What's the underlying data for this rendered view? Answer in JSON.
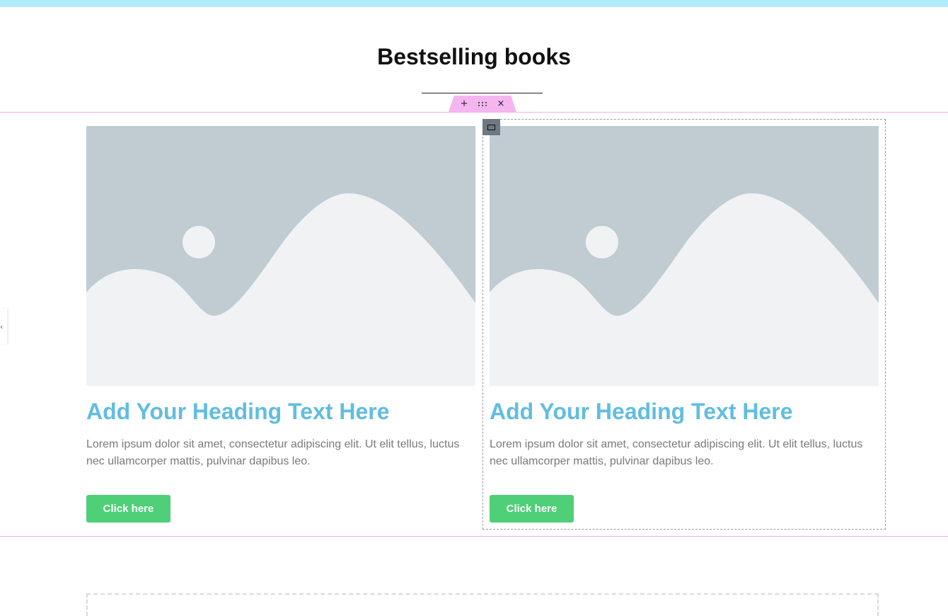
{
  "page": {
    "title": "Bestselling books"
  },
  "toolbar": {
    "add_icon": "+",
    "close_icon": "×",
    "collapse_icon": "‹"
  },
  "cards": [
    {
      "heading": "Add Your Heading Text Here",
      "text": "Lorem ipsum dolor sit amet, consectetur adipiscing elit. Ut elit tellus, luctus nec ullamcorper mattis, pulvinar dapibus leo.",
      "button_label": "Click here"
    },
    {
      "heading": "Add Your Heading Text Here",
      "text": "Lorem ipsum dolor sit amet, consectetur adipiscing elit. Ut elit tellus, luctus nec ullamcorper mattis, pulvinar dapibus leo.",
      "button_label": "Click here"
    }
  ],
  "colors": {
    "top_strip": "#b2ebfd",
    "section_outline": "#f5a9ee",
    "heading_accent": "#61bddf",
    "button": "#4fcf77",
    "placeholder_bg": "#c0ccd2",
    "placeholder_fg": "#f1f2f4"
  },
  "icons": {
    "image_placeholder": "image-placeholder-icon",
    "drag_handle": "drag-dots-icon",
    "column_handle": "column-icon"
  }
}
